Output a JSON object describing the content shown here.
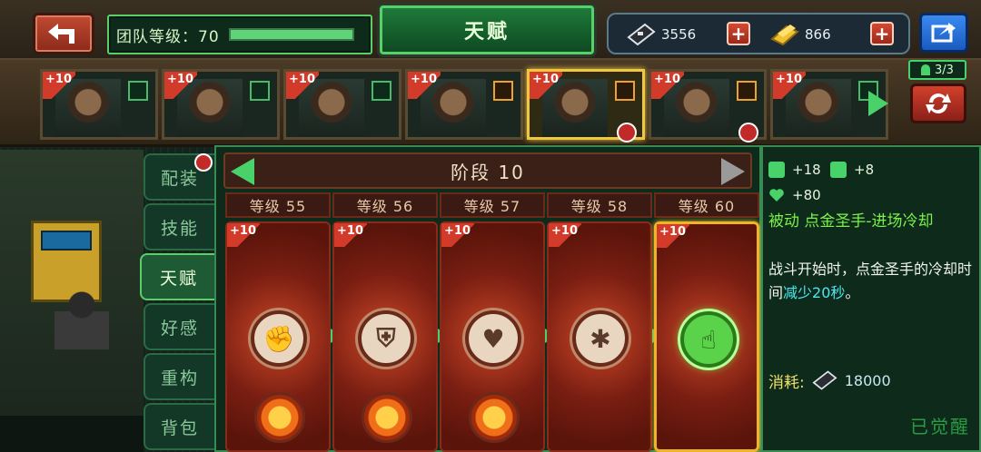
{
  "topbar": {
    "team_level_label": "团队等级：70",
    "team_level_progress": 1.0,
    "title": "天赋",
    "gems": "3556",
    "gold": "866"
  },
  "heroes": [
    {
      "badge": "+10",
      "role": "green-person",
      "selected": false
    },
    {
      "badge": "+10",
      "role": "green-person",
      "selected": false
    },
    {
      "badge": "+10",
      "role": "green-person",
      "selected": false
    },
    {
      "badge": "+10",
      "role": "orange-arrow",
      "selected": false
    },
    {
      "badge": "+10",
      "role": "orange-arrow",
      "selected": true
    },
    {
      "badge": "+10",
      "role": "orange-arrow",
      "selected": false
    },
    {
      "badge": "+10",
      "role": "green-person",
      "selected": false
    }
  ],
  "team_count": "3/3",
  "side_tabs": [
    "配装",
    "技能",
    "天赋",
    "好感",
    "重构",
    "背包"
  ],
  "active_tab": "天赋",
  "stage_label": "阶段 10",
  "levels": [
    {
      "label": "等级 55",
      "badge": "+10",
      "icon": "fist-icon",
      "secondary_icon": "arm-icon",
      "current": false
    },
    {
      "label": "等级 56",
      "badge": "+10",
      "icon": "shield-icon",
      "secondary_icon": "sun-icon",
      "current": false
    },
    {
      "label": "等级 57",
      "badge": "+10",
      "icon": "heart-icon",
      "secondary_icon": "heart-icon",
      "current": false
    },
    {
      "label": "等级 58",
      "badge": "+10",
      "icon": "burst-icon",
      "secondary_icon": "",
      "current": false
    },
    {
      "label": "等级 60",
      "badge": "+10",
      "icon": "golden-hand-icon",
      "secondary_icon": "",
      "current": true
    }
  ],
  "detail": {
    "stat_attack": "+18",
    "stat_defense": "+8",
    "stat_hp": "+80",
    "skill_name": "被动 点金圣手-进场冷却",
    "desc_prefix": "战斗开始时，点金圣手的冷却时间",
    "desc_highlight": "减少20秒",
    "desc_suffix": "。",
    "cost_label": "消耗:",
    "cost_value": "18000",
    "status": "已觉醒"
  },
  "colors": {
    "accent_green": "#4ad26a",
    "highlight_cyan": "#4ae8f0",
    "gold_border": "#f0b428"
  }
}
